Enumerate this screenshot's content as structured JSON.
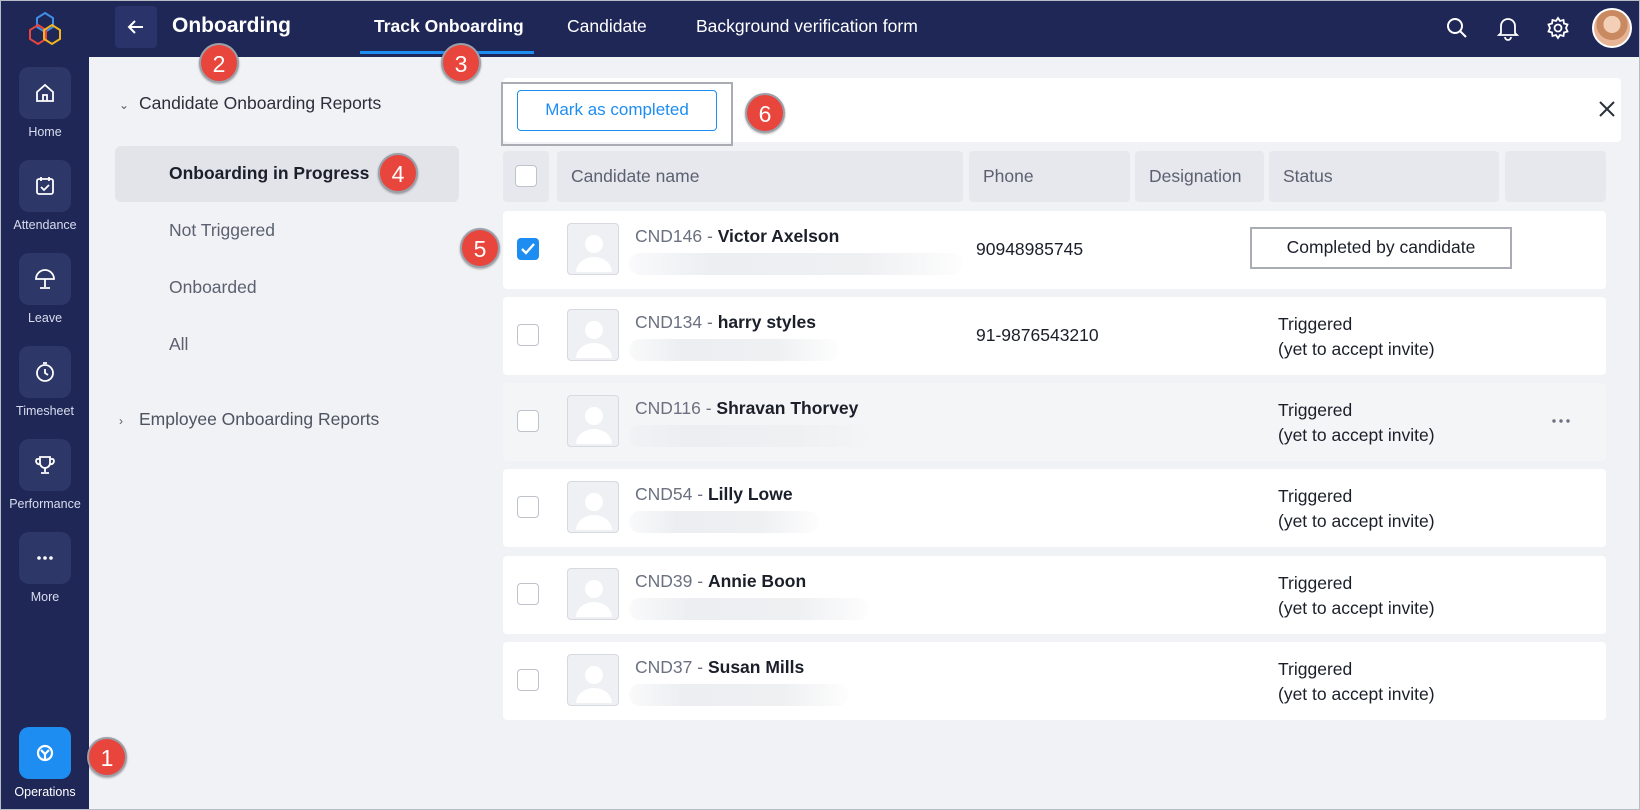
{
  "rail": {
    "items": [
      {
        "label": "Home",
        "icon": "home-icon"
      },
      {
        "label": "Attendance",
        "icon": "calendar-check-icon"
      },
      {
        "label": "Leave",
        "icon": "umbrella-icon"
      },
      {
        "label": "Timesheet",
        "icon": "stopwatch-icon"
      },
      {
        "label": "Performance",
        "icon": "trophy-icon"
      },
      {
        "label": "More",
        "icon": "more-horizontal-icon"
      }
    ],
    "active_item": {
      "label": "Operations",
      "icon": "operations-icon"
    }
  },
  "topbar": {
    "title": "Onboarding",
    "tabs": [
      {
        "label": "Track Onboarding",
        "active": true
      },
      {
        "label": "Candidate",
        "active": false
      },
      {
        "label": "Background verification form",
        "active": false
      }
    ]
  },
  "sidepanel": {
    "section_candidate": "Candidate Onboarding Reports",
    "items": [
      "Onboarding in Progress",
      "Not Triggered",
      "Onboarded",
      "All"
    ],
    "section_employee": "Employee Onboarding Reports"
  },
  "actions": {
    "mark_completed": "Mark as completed"
  },
  "table": {
    "headers": [
      "Candidate name",
      "Phone",
      "Designation",
      "Status"
    ],
    "rows": [
      {
        "id": "CND146",
        "name": "Victor Axelson",
        "phone": "90948985745",
        "status": "Completed by candidate",
        "checked": true
      },
      {
        "id": "CND134",
        "name": "harry styles",
        "phone": "91-9876543210",
        "status": "Triggered",
        "status_sub": "(yet to accept invite)",
        "checked": false
      },
      {
        "id": "CND116",
        "name": "Shravan Thorvey",
        "phone": "",
        "status": "Triggered",
        "status_sub": "(yet to accept invite)",
        "checked": false
      },
      {
        "id": "CND54",
        "name": "Lilly Lowe",
        "phone": "",
        "status": "Triggered",
        "status_sub": "(yet to accept invite)",
        "checked": false
      },
      {
        "id": "CND39",
        "name": "Annie Boon",
        "phone": "",
        "status": "Triggered",
        "status_sub": "(yet to accept invite)",
        "checked": false
      },
      {
        "id": "CND37",
        "name": "Susan Mills",
        "phone": "",
        "status": "Triggered",
        "status_sub": "(yet to accept invite)",
        "checked": false
      }
    ],
    "separator": " - "
  },
  "callouts": [
    "1",
    "2",
    "3",
    "4",
    "5",
    "6"
  ],
  "colors": {
    "navy": "#1f2757",
    "accent": "#1d8df2",
    "callout": "#e8453c"
  }
}
